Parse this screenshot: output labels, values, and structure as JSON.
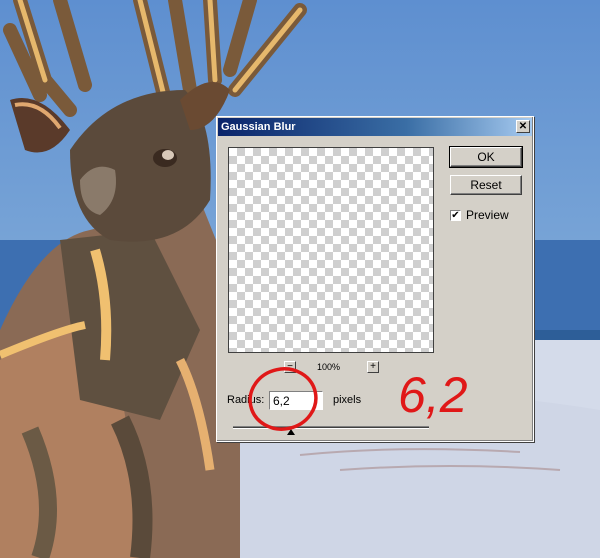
{
  "dialog": {
    "title": "Gaussian Blur",
    "close_glyph": "✕",
    "ok_label": "OK",
    "reset_label": "Reset",
    "preview_label": "Preview",
    "preview_checked": true,
    "check_glyph": "✔",
    "zoom_minus": "−",
    "zoom_plus": "+",
    "zoom_level": "100%",
    "radius_label": "Radius:",
    "radius_value": "6,2",
    "unit_label": "pixels"
  },
  "annotation": {
    "text": "6,2",
    "color": "#e01818"
  },
  "colors": {
    "titlebar_start": "#0a246a",
    "dialog_bg": "#d4d0c8",
    "sky": "#6f9ccf"
  },
  "icons": [
    "close-icon",
    "checkbox-check-icon",
    "zoom-out-icon",
    "zoom-in-icon",
    "slider-thumb-icon"
  ]
}
